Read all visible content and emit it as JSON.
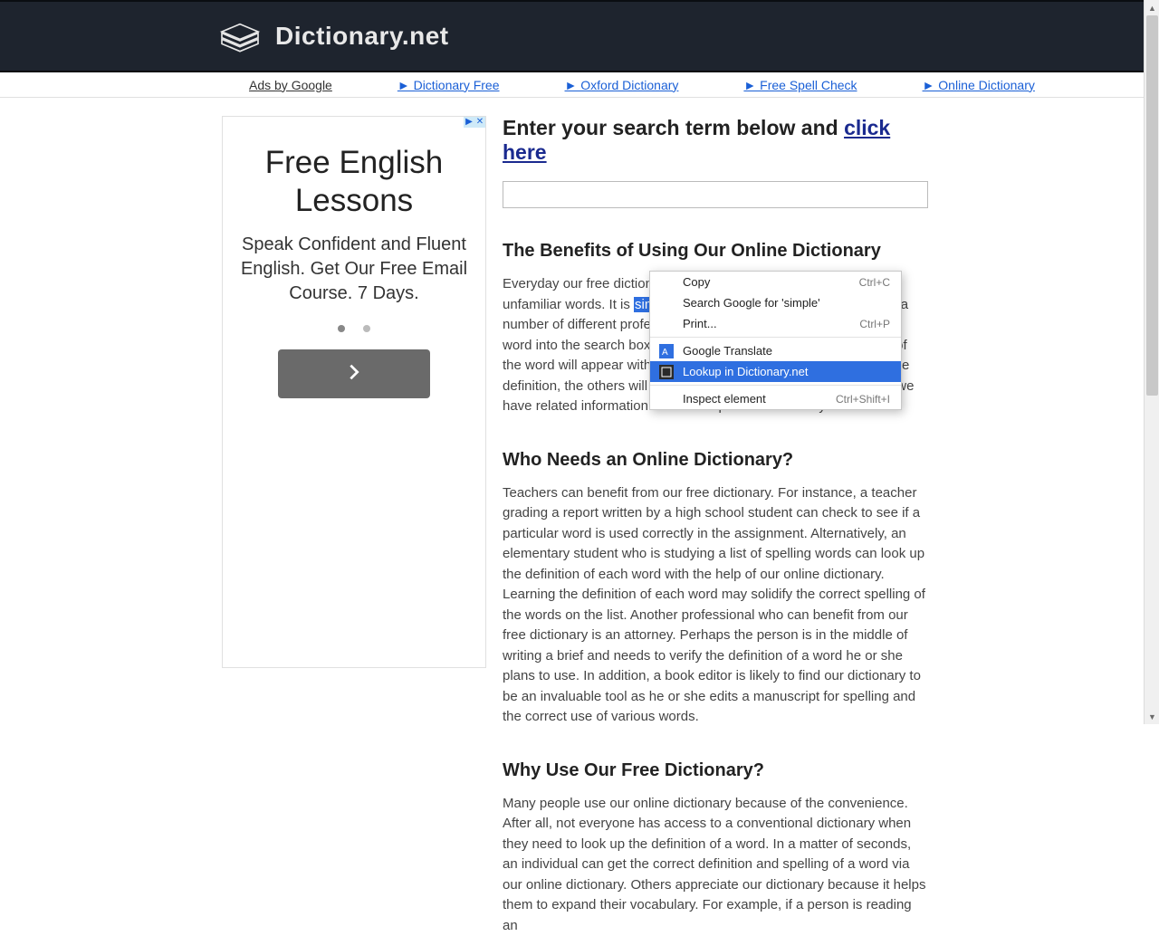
{
  "header": {
    "site_title": "Dictionary.net"
  },
  "adbar": {
    "label": "Ads by Google",
    "links": [
      "► Dictionary Free",
      "► Oxford Dictionary",
      "► Free Spell Check",
      "► Online Dictionary"
    ]
  },
  "sidebar_ad": {
    "title": "Free English Lessons",
    "subtitle": "Speak Confident and Fluent English. Get Our Free Email Course. 7 Days.",
    "close_glyph": "✕",
    "info_glyph": "▶"
  },
  "main": {
    "prompt_prefix": "Enter your search term below and ",
    "prompt_link": "click here",
    "sections": {
      "benefits": {
        "heading": "The Benefits of Using Our Online Dictionary",
        "para_pre": "Everyday our free dictionary helps people to find the definitions of unfamiliar words. It is ",
        "highlighted_word": "simple",
        "para_post": " to use as well as helpful to people in a number of different professions. A person simply types a particular word into the search box, then clicks search. The correct spelling of the word will appear within moments. If the word has more than one definition, the others will appear as well. In addition to definitions, we have related information that accompanies each entry.",
        "who_heading": "Who Needs an Online Dictionary?",
        "who_para": "Teachers can benefit from our free dictionary. For instance, a teacher grading a report written by a high school student can check to see if a particular word is used correctly in the assignment. Alternatively, an elementary student who is studying a list of spelling words can look up the definition of each word with the help of our online dictionary. Learning the definition of each word may solidify the correct spelling of the words on the list. Another professional who can benefit from our free dictionary is an attorney. Perhaps the person is in the middle of writing a brief and needs to verify the definition of a word he or she plans to use. In addition, a book editor is likely to find our dictionary to be an invaluable tool as he or she edits a manuscript for spelling and the correct use of various words.",
        "why_heading": "Why Use Our Free Dictionary?",
        "why_para": "Many people use our online dictionary because of the convenience. After all, not everyone has access to a conventional dictionary when they need to look up the definition of a word. In a matter of seconds, an individual can get the correct definition and spelling of a word via our online dictionary. Others appreciate our dictionary because it helps them to expand their vocabulary. For example, if a person is reading an"
      }
    }
  },
  "context_menu": {
    "items": [
      {
        "label": "Copy",
        "shortcut": "Ctrl+C"
      },
      {
        "label": "Search Google for 'simple'",
        "shortcut": ""
      },
      {
        "label": "Print...",
        "shortcut": "Ctrl+P"
      }
    ],
    "items2": [
      {
        "label": "Google Translate",
        "shortcut": "",
        "icon": "translate"
      },
      {
        "label": "Lookup in Dictionary.net",
        "shortcut": "",
        "icon": "dict",
        "hover": true
      }
    ],
    "items3": [
      {
        "label": "Inspect element",
        "shortcut": "Ctrl+Shift+I"
      }
    ]
  },
  "scrollbar": {
    "up_glyph": "▲",
    "down_glyph": "▼"
  }
}
